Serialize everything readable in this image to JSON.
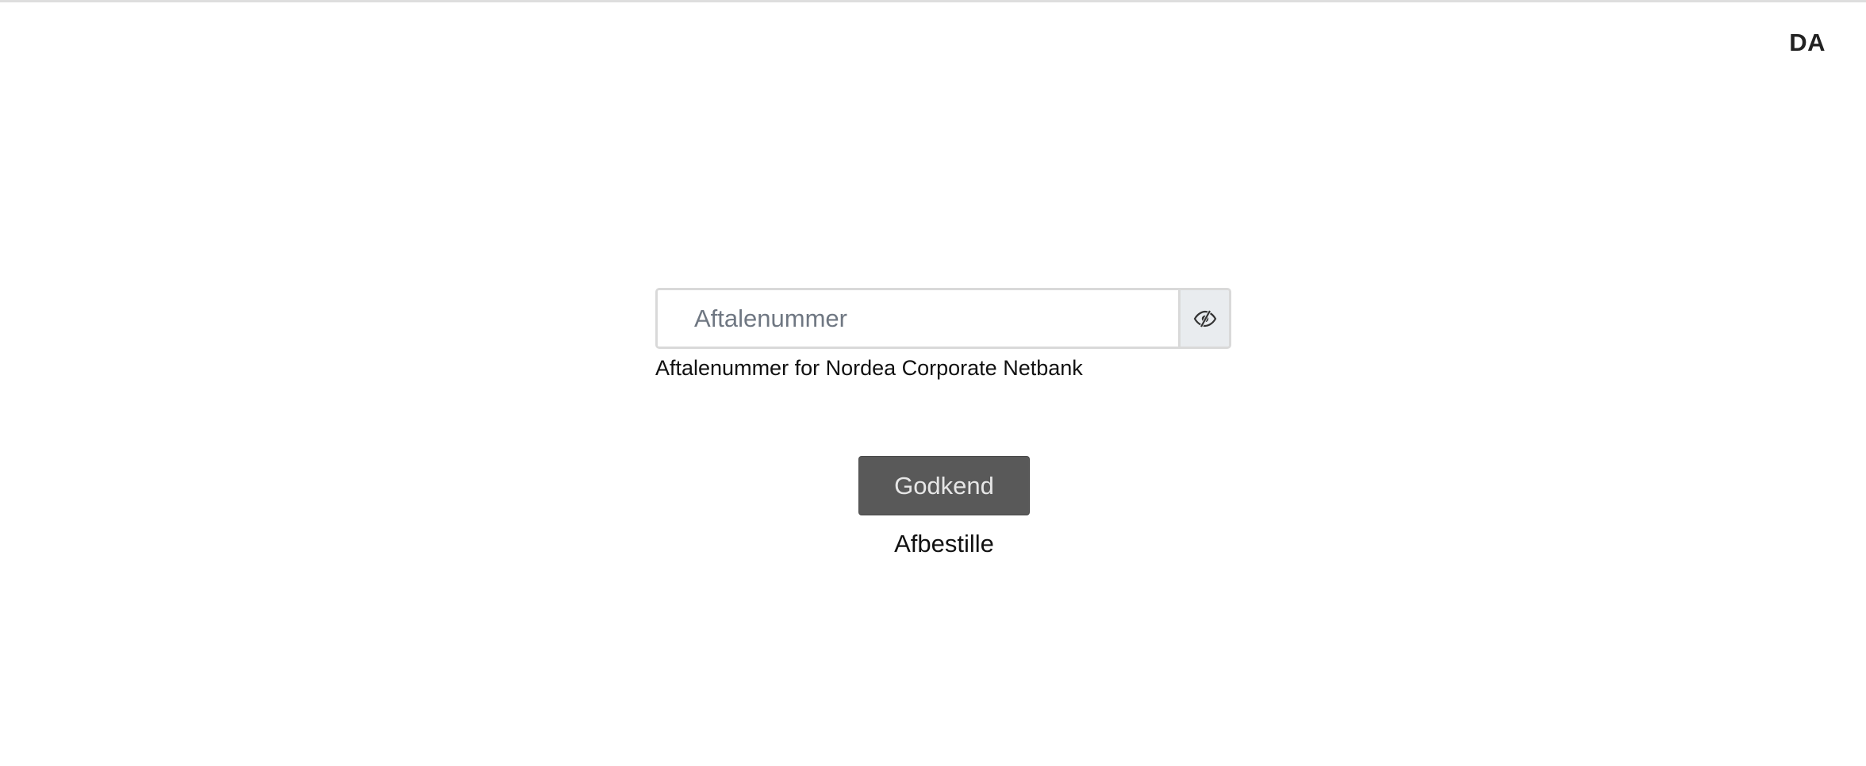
{
  "header": {
    "language": "DA"
  },
  "form": {
    "agreement_input": {
      "value": "",
      "placeholder": "Aftalenummer",
      "visibility_icon": "eye-slash-icon"
    },
    "help_text": "Aftalenummer for Nordea Corporate Netbank",
    "approve_label": "Godkend",
    "cancel_label": "Afbestille"
  },
  "colors": {
    "button_bg": "#595959",
    "button_text": "#e6e6e6",
    "input_border": "#d9d9d9",
    "addon_bg": "#e9ecef"
  }
}
